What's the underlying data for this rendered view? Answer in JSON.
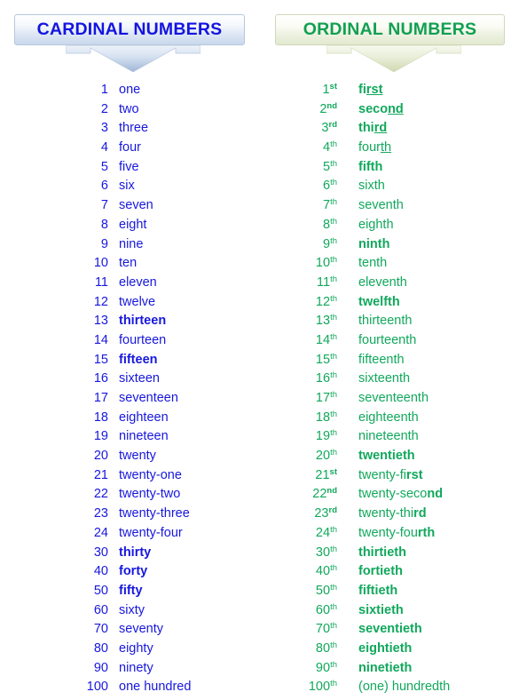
{
  "headers": {
    "cardinal": {
      "label": "CARDINAL NUMBERS",
      "color": "#1414e0",
      "arrow_icon": "down-arrow-icon"
    },
    "ordinal": {
      "label": "ORDINAL NUMBERS",
      "color": "#11a052",
      "arrow_icon": "down-arrow-icon"
    }
  },
  "cardinal_rows": [
    {
      "num": "1",
      "word": "one",
      "bold": false
    },
    {
      "num": "2",
      "word": "two",
      "bold": false
    },
    {
      "num": "3",
      "word": "three",
      "bold": false
    },
    {
      "num": "4",
      "word": "four",
      "bold": false
    },
    {
      "num": "5",
      "word": "five",
      "bold": false
    },
    {
      "num": "6",
      "word": "six",
      "bold": false
    },
    {
      "num": "7",
      "word": "seven",
      "bold": false
    },
    {
      "num": "8",
      "word": "eight",
      "bold": false
    },
    {
      "num": "9",
      "word": "nine",
      "bold": false
    },
    {
      "num": "10",
      "word": "ten",
      "bold": false
    },
    {
      "num": "11",
      "word": "eleven",
      "bold": false
    },
    {
      "num": "12",
      "word": "twelve",
      "bold": false
    },
    {
      "num": "13",
      "word": "thirteen",
      "bold": true
    },
    {
      "num": "14",
      "word": "fourteen",
      "bold": false
    },
    {
      "num": "15",
      "word": "fifteen",
      "bold": true
    },
    {
      "num": "16",
      "word": "sixteen",
      "bold": false
    },
    {
      "num": "17",
      "word": "seventeen",
      "bold": false
    },
    {
      "num": "18",
      "word": "eighteen",
      "bold": false
    },
    {
      "num": "19",
      "word": "nineteen",
      "bold": false
    },
    {
      "num": "20",
      "word": "twenty",
      "bold": false
    },
    {
      "num": "21",
      "word": "twenty-one",
      "bold": false
    },
    {
      "num": "22",
      "word": "twenty-two",
      "bold": false
    },
    {
      "num": "23",
      "word": "twenty-three",
      "bold": false
    },
    {
      "num": "24",
      "word": "twenty-four",
      "bold": false
    },
    {
      "num": "30",
      "word": "thirty",
      "bold": true
    },
    {
      "num": "40",
      "word": "forty",
      "bold": true
    },
    {
      "num": "50",
      "word": "fifty",
      "bold": true
    },
    {
      "num": "60",
      "word": "sixty",
      "bold": false
    },
    {
      "num": "70",
      "word": "seventy",
      "bold": false
    },
    {
      "num": "80",
      "word": "eighty",
      "bold": false
    },
    {
      "num": "90",
      "word": "ninety",
      "bold": false
    },
    {
      "num": "100",
      "word": "one hundred",
      "bold": false
    }
  ],
  "ordinal_rows": [
    {
      "num": "1",
      "suffix": "st",
      "suffix_bold": true,
      "stem": "fi",
      "tail": "rst",
      "tail_style": "bold-underline",
      "word_bold": true
    },
    {
      "num": "2",
      "suffix": "nd",
      "suffix_bold": true,
      "stem": "seco",
      "tail": "nd",
      "tail_style": "bold-underline",
      "word_bold": true
    },
    {
      "num": "3",
      "suffix": "rd",
      "suffix_bold": true,
      "stem": "thi",
      "tail": "rd",
      "tail_style": "bold-underline",
      "word_bold": true
    },
    {
      "num": "4",
      "suffix": "th",
      "suffix_bold": false,
      "stem": "four",
      "tail": "th",
      "tail_style": "underline",
      "word_bold": false
    },
    {
      "num": "5",
      "suffix": "th",
      "suffix_bold": false,
      "stem": "fifth",
      "tail": "",
      "tail_style": "none",
      "word_bold": true
    },
    {
      "num": "6",
      "suffix": "th",
      "suffix_bold": false,
      "stem": "sixth",
      "tail": "",
      "tail_style": "none",
      "word_bold": false
    },
    {
      "num": "7",
      "suffix": "th",
      "suffix_bold": false,
      "stem": "seventh",
      "tail": "",
      "tail_style": "none",
      "word_bold": false
    },
    {
      "num": "8",
      "suffix": "th",
      "suffix_bold": false,
      "stem": "eighth",
      "tail": "",
      "tail_style": "none",
      "word_bold": false
    },
    {
      "num": "9",
      "suffix": "th",
      "suffix_bold": false,
      "stem": "ninth",
      "tail": "",
      "tail_style": "none",
      "word_bold": true
    },
    {
      "num": "10",
      "suffix": "th",
      "suffix_bold": false,
      "stem": "tenth",
      "tail": "",
      "tail_style": "none",
      "word_bold": false
    },
    {
      "num": "11",
      "suffix": "th",
      "suffix_bold": false,
      "stem": "eleventh",
      "tail": "",
      "tail_style": "none",
      "word_bold": false
    },
    {
      "num": "12",
      "suffix": "th",
      "suffix_bold": false,
      "stem": "twelfth",
      "tail": "",
      "tail_style": "none",
      "word_bold": true
    },
    {
      "num": "13",
      "suffix": "th",
      "suffix_bold": false,
      "stem": "thirteenth",
      "tail": "",
      "tail_style": "none",
      "word_bold": false
    },
    {
      "num": "14",
      "suffix": "th",
      "suffix_bold": false,
      "stem": "fourteenth",
      "tail": "",
      "tail_style": "none",
      "word_bold": false
    },
    {
      "num": "15",
      "suffix": "th",
      "suffix_bold": false,
      "stem": "fifteenth",
      "tail": "",
      "tail_style": "none",
      "word_bold": false
    },
    {
      "num": "16",
      "suffix": "th",
      "suffix_bold": false,
      "stem": "sixteenth",
      "tail": "",
      "tail_style": "none",
      "word_bold": false
    },
    {
      "num": "17",
      "suffix": "th",
      "suffix_bold": false,
      "stem": "seventeenth",
      "tail": "",
      "tail_style": "none",
      "word_bold": false
    },
    {
      "num": "18",
      "suffix": "th",
      "suffix_bold": false,
      "stem": "eighteenth",
      "tail": "",
      "tail_style": "none",
      "word_bold": false
    },
    {
      "num": "19",
      "suffix": "th",
      "suffix_bold": false,
      "stem": "nineteenth",
      "tail": "",
      "tail_style": "none",
      "word_bold": false
    },
    {
      "num": "20",
      "suffix": "th",
      "suffix_bold": false,
      "stem": "twentieth",
      "tail": "",
      "tail_style": "none",
      "word_bold": true
    },
    {
      "num": "21",
      "suffix": "st",
      "suffix_bold": true,
      "stem": "twenty-fi",
      "tail": "rst",
      "tail_style": "bold",
      "word_bold": false
    },
    {
      "num": "22",
      "suffix": "nd",
      "suffix_bold": true,
      "stem": "twenty-seco",
      "tail": "nd",
      "tail_style": "bold",
      "word_bold": false
    },
    {
      "num": "23",
      "suffix": "rd",
      "suffix_bold": true,
      "stem": "twenty-thi",
      "tail": "rd",
      "tail_style": "bold",
      "word_bold": false
    },
    {
      "num": "24",
      "suffix": "th",
      "suffix_bold": false,
      "stem": "twenty-fou",
      "tail": "rth",
      "tail_style": "bold",
      "word_bold": false
    },
    {
      "num": "30",
      "suffix": "th",
      "suffix_bold": false,
      "stem": "thirtieth",
      "tail": "",
      "tail_style": "none",
      "word_bold": true
    },
    {
      "num": "40",
      "suffix": "th",
      "suffix_bold": false,
      "stem": "fortieth",
      "tail": "",
      "tail_style": "none",
      "word_bold": true
    },
    {
      "num": "50",
      "suffix": "th",
      "suffix_bold": false,
      "stem": "fiftieth",
      "tail": "",
      "tail_style": "none",
      "word_bold": true
    },
    {
      "num": "60",
      "suffix": "th",
      "suffix_bold": false,
      "stem": "sixtieth",
      "tail": "",
      "tail_style": "none",
      "word_bold": true
    },
    {
      "num": "70",
      "suffix": "th",
      "suffix_bold": false,
      "stem": "seventieth",
      "tail": "",
      "tail_style": "none",
      "word_bold": true
    },
    {
      "num": "80",
      "suffix": "th",
      "suffix_bold": false,
      "stem": "eightieth",
      "tail": "",
      "tail_style": "none",
      "word_bold": true
    },
    {
      "num": "90",
      "suffix": "th",
      "suffix_bold": false,
      "stem": "ninetieth",
      "tail": "",
      "tail_style": "none",
      "word_bold": true
    },
    {
      "num": "100",
      "suffix": "th",
      "suffix_bold": false,
      "stem": "(one) hundredth",
      "tail": "",
      "tail_style": "none",
      "word_bold": false
    }
  ]
}
